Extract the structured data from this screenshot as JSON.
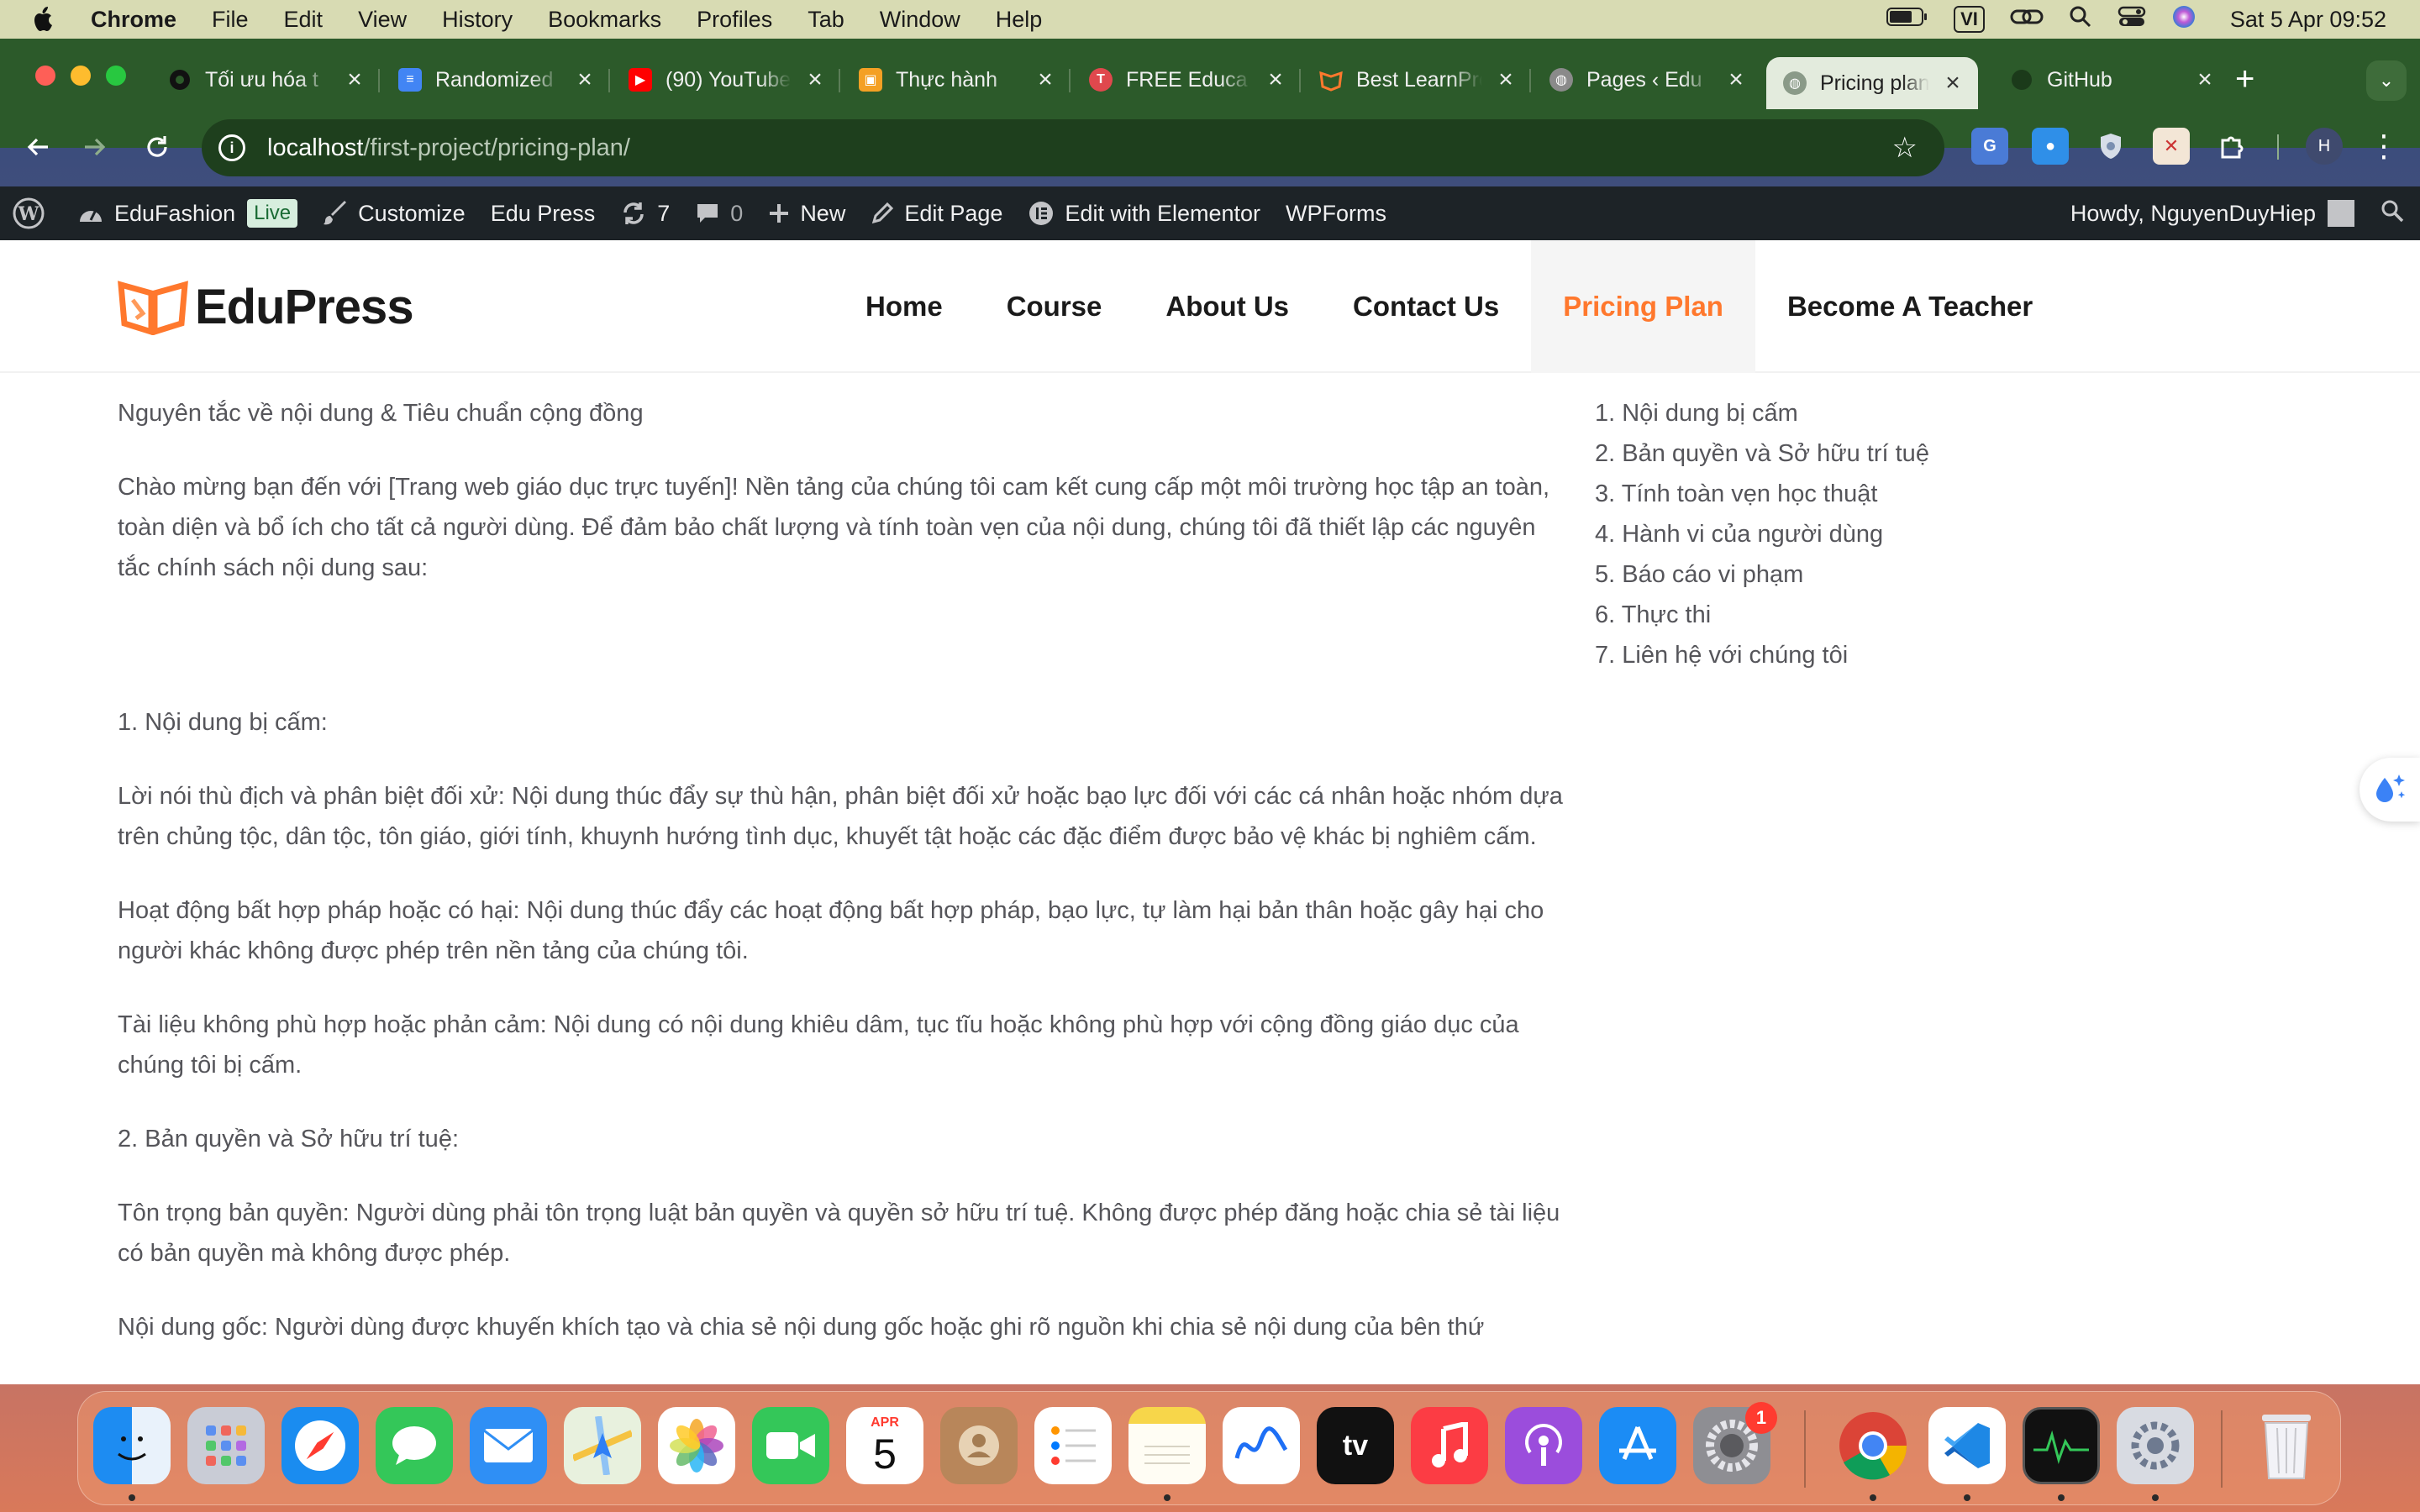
{
  "menubar": {
    "items": [
      "Chrome",
      "File",
      "Edit",
      "View",
      "History",
      "Bookmarks",
      "Profiles",
      "Tab",
      "Window",
      "Help"
    ],
    "input_method": "VI",
    "clock": "Sat 5 Apr  09:52"
  },
  "tabs": [
    {
      "title": "Tối ưu hóa t",
      "favicon": "github-icon",
      "color": "#111111"
    },
    {
      "title": "Randomized",
      "favicon": "docs-icon",
      "color": "#4285f4"
    },
    {
      "title": "(90) YouTube",
      "favicon": "youtube-icon",
      "color": "#ff0000"
    },
    {
      "title": "Thực hành",
      "favicon": "slides-icon",
      "color": "#f4a024"
    },
    {
      "title": "FREE Educa",
      "favicon": "edu-icon",
      "color": "#e0484d"
    },
    {
      "title": "Best LearnPress",
      "favicon": "learnpress-icon",
      "color": "#ff782d"
    },
    {
      "title": "Pages ‹ Edu",
      "favicon": "globe-icon",
      "color": "#8a8a8a"
    },
    {
      "title": "Pricing plan",
      "favicon": "globe-icon",
      "color": "#8a8a8a",
      "active": true
    },
    {
      "title": "GitHub",
      "favicon": "github-icon",
      "color": "#111111"
    }
  ],
  "address": {
    "host": "localhost",
    "path": "/first-project/pricing-plan/"
  },
  "wpbar": {
    "site_name": "EduFashion",
    "live": "Live",
    "customize": "Customize",
    "theme": "Edu Press",
    "updates": "7",
    "comments": "0",
    "new": "New",
    "edit_page": "Edit Page",
    "elementor": "Edit with Elementor",
    "wpforms": "WPForms",
    "howdy": "Howdy, NguyenDuyHiep"
  },
  "site": {
    "brand": "EduPress",
    "nav": [
      "Home",
      "Course",
      "About Us",
      "Contact Us",
      "Pricing Plan",
      "Become A Teacher"
    ],
    "active_nav": "Pricing Plan",
    "accent": "#ff782d"
  },
  "content": {
    "heading": "Nguyên tắc về nội dung & Tiêu chuẩn cộng đồng",
    "intro": "Chào mừng bạn đến với [Trang web giáo dục trực tuyến]! Nền tảng của chúng tôi cam kết cung cấp một môi trường học tập an toàn, toàn diện và bổ ích cho tất cả người dùng. Để đảm bảo chất lượng và tính toàn vẹn của nội dung, chúng tôi đã thiết lập các nguyên tắc chính sách nội dung sau:",
    "section1": "1. Nội dung bị cấm:",
    "p1": "Lời nói thù địch và phân biệt đối xử: Nội dung thúc đẩy sự thù hận, phân biệt đối xử hoặc bạo lực đối với các cá nhân hoặc nhóm dựa trên chủng tộc, dân tộc, tôn giáo, giới tính, khuynh hướng tình dục, khuyết tật hoặc các đặc điểm được bảo vệ khác bị nghiêm cấm.",
    "p2": "Hoạt động bất hợp pháp hoặc có hại: Nội dung thúc đẩy các hoạt động bất hợp pháp, bạo lực, tự làm hại bản thân hoặc gây hại cho người khác không được phép trên nền tảng của chúng tôi.",
    "p3": "Tài liệu không phù hợp hoặc phản cảm: Nội dung có nội dung khiêu dâm, tục tĩu hoặc không phù hợp với cộng đồng giáo dục của chúng tôi bị cấm.",
    "section2": "2. Bản quyền và Sở hữu trí tuệ:",
    "p4": "Tôn trọng bản quyền: Người dùng phải tôn trọng luật bản quyền và quyền sở hữu trí tuệ. Không được phép đăng hoặc chia sẻ tài liệu có bản quyền mà không được phép.",
    "p5": "Nội dung gốc: Người dùng được khuyến khích tạo và chia sẻ nội dung gốc hoặc ghi rõ nguồn khi chia sẻ nội dung của bên thứ"
  },
  "toc": [
    "1. Nội dung bị cấm",
    "2. Bản quyền và Sở hữu trí tuệ",
    "3. Tính toàn vẹn học thuật",
    "4. Hành vi của người dùng",
    "5. Báo cáo vi phạm",
    "6. Thực thi",
    "7. Liên hệ với chúng tôi"
  ],
  "dock": {
    "calendar_month": "APR",
    "calendar_day": "5",
    "settings_badge": "1",
    "apps": [
      "finder-icon",
      "launchpad-icon",
      "safari-icon",
      "messages-icon",
      "mail-icon",
      "maps-icon",
      "photos-icon",
      "facetime-icon",
      "calendar-icon",
      "contacts-icon",
      "reminders-icon",
      "notes-icon",
      "freeform-icon",
      "tv-icon",
      "music-icon",
      "podcasts-icon",
      "appstore-icon",
      "settings-icon",
      "chrome-icon",
      "vscode-icon",
      "activity-monitor-icon",
      "system-info-icon",
      "trash-icon"
    ]
  }
}
